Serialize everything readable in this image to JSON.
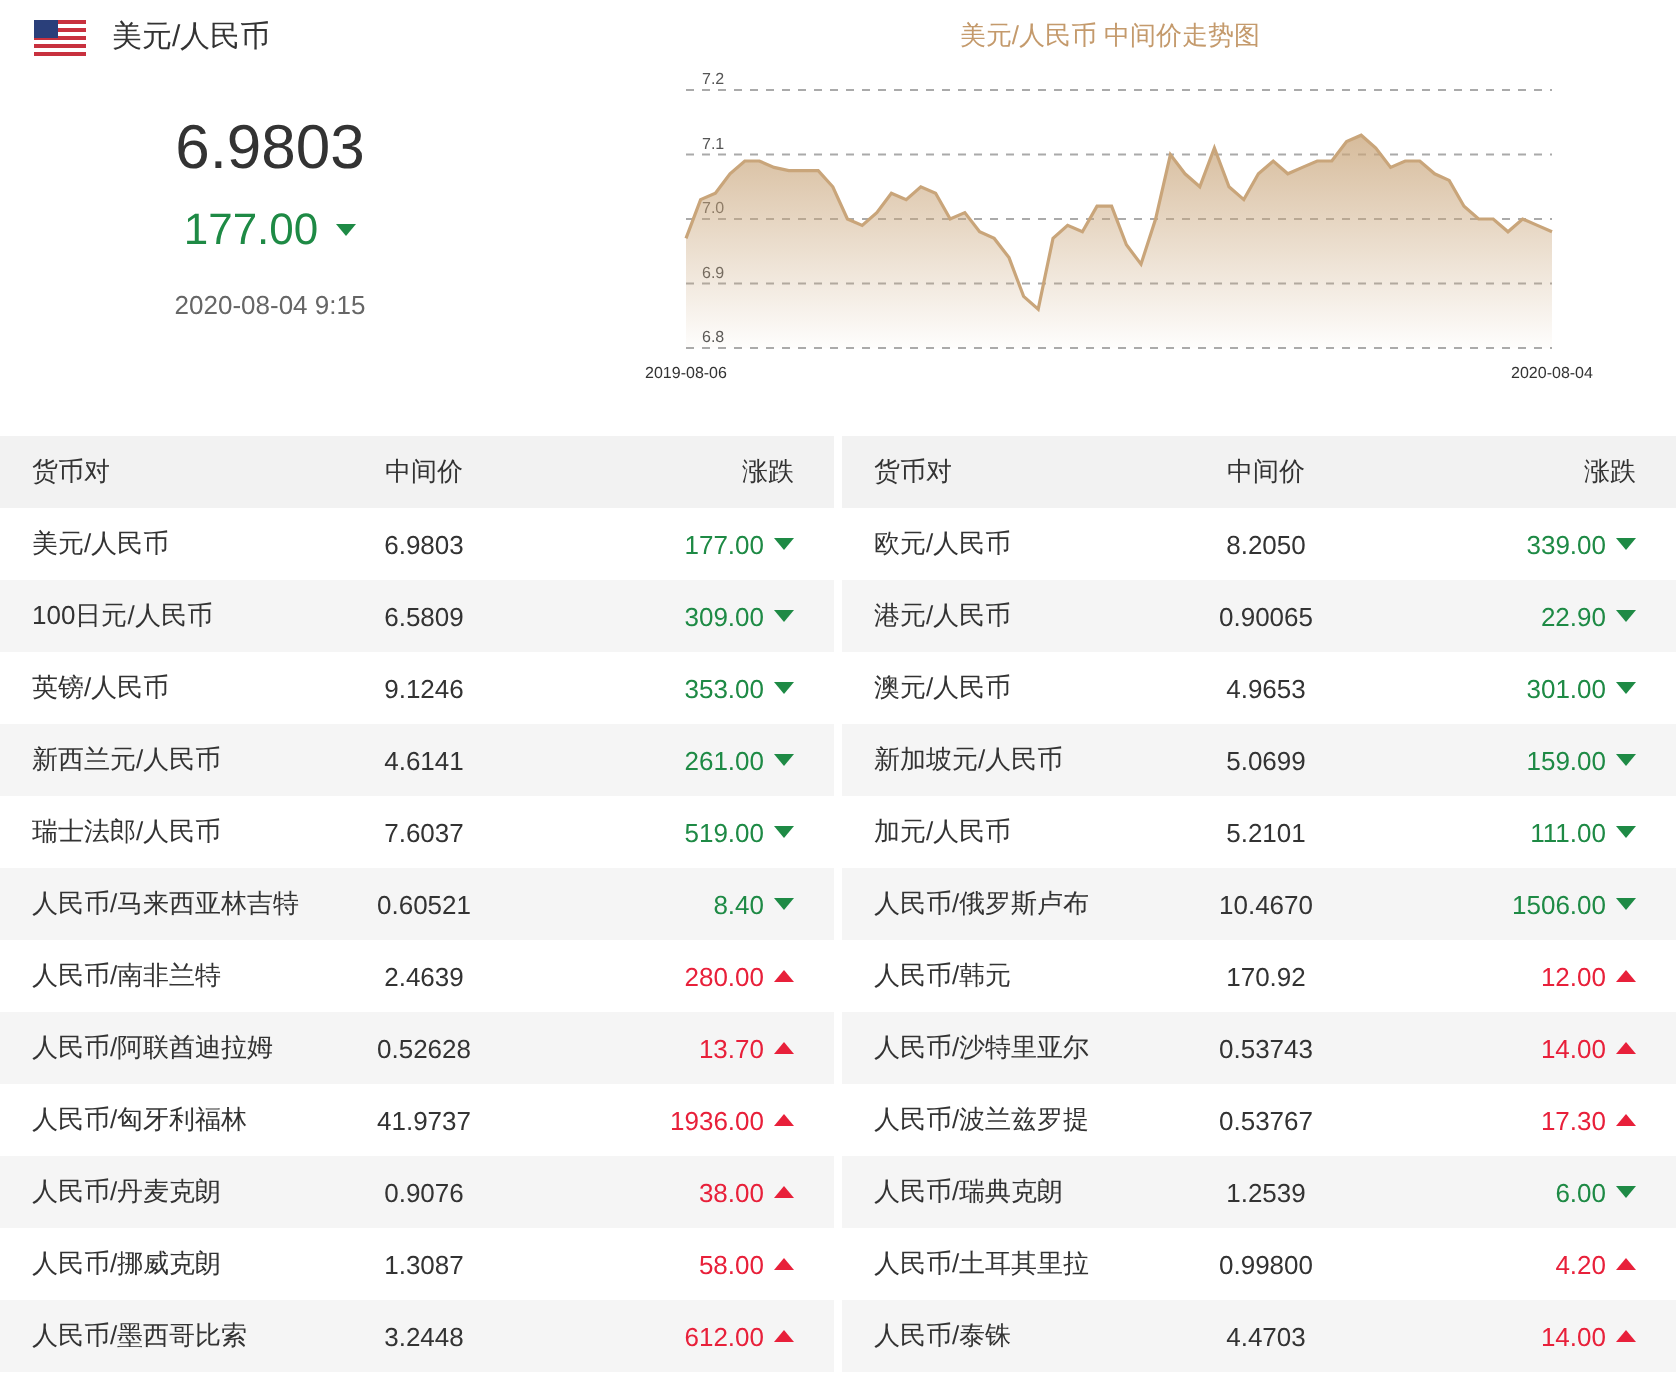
{
  "summary": {
    "pair": "美元/人民币",
    "price": "6.9803",
    "change": "177.00",
    "rising": false,
    "time": "2020-08-04 9:15"
  },
  "chart": {
    "title": "美元/人民币 中间价走势图",
    "x_start": "2019-08-06",
    "x_end": "2020-08-04",
    "chart_data": {
      "type": "area",
      "grid": true,
      "yticks": [
        6.8,
        6.9,
        {
          "value": 7,
          "label": "7.0"
        },
        7.1,
        7.2
      ],
      "ylim": [
        6.8,
        7.2
      ],
      "series": [
        {
          "color": "#c9a57a",
          "values": [
            6.97,
            7.03,
            7.04,
            7.07,
            7.09,
            7.09,
            7.08,
            7.075,
            7.075,
            7.075,
            7.05,
            7.0,
            6.99,
            7.01,
            7.04,
            7.03,
            7.05,
            7.04,
            7.0,
            7.01,
            6.98,
            6.97,
            6.94,
            6.88,
            6.86,
            6.97,
            6.99,
            6.98,
            7.02,
            7.02,
            6.96,
            6.93,
            7.0,
            7.1,
            7.07,
            7.05,
            7.11,
            7.05,
            7.03,
            7.07,
            7.09,
            7.07,
            7.08,
            7.09,
            7.09,
            7.12,
            7.13,
            7.11,
            7.08,
            7.09,
            7.09,
            7.07,
            7.06,
            7.02,
            7.0,
            7.0,
            6.98,
            7.0,
            6.99,
            6.98
          ]
        }
      ]
    }
  },
  "tables": [
    {
      "columns": [
        "货币对",
        "中间价",
        "涨跌"
      ],
      "rows": [
        {
          "pair": "美元/人民币",
          "price": "6.9803",
          "change": "177.00",
          "rising": false
        },
        {
          "pair": "100日元/人民币",
          "price": "6.5809",
          "change": "309.00",
          "rising": false
        },
        {
          "pair": "英镑/人民币",
          "price": "9.1246",
          "change": "353.00",
          "rising": false
        },
        {
          "pair": "新西兰元/人民币",
          "price": "4.6141",
          "change": "261.00",
          "rising": false
        },
        {
          "pair": "瑞士法郎/人民币",
          "price": "7.6037",
          "change": "519.00",
          "rising": false
        },
        {
          "pair": "人民币/马来西亚林吉特",
          "price": "0.60521",
          "change": "8.40",
          "rising": false
        },
        {
          "pair": "人民币/南非兰特",
          "price": "2.4639",
          "change": "280.00",
          "rising": true
        },
        {
          "pair": "人民币/阿联酋迪拉姆",
          "price": "0.52628",
          "change": "13.70",
          "rising": true
        },
        {
          "pair": "人民币/匈牙利福林",
          "price": "41.9737",
          "change": "1936.00",
          "rising": true
        },
        {
          "pair": "人民币/丹麦克朗",
          "price": "0.9076",
          "change": "38.00",
          "rising": true
        },
        {
          "pair": "人民币/挪威克朗",
          "price": "1.3087",
          "change": "58.00",
          "rising": true
        },
        {
          "pair": "人民币/墨西哥比索",
          "price": "3.2448",
          "change": "612.00",
          "rising": true
        }
      ]
    },
    {
      "columns": [
        "货币对",
        "中间价",
        "涨跌"
      ],
      "rows": [
        {
          "pair": "欧元/人民币",
          "price": "8.2050",
          "change": "339.00",
          "rising": false
        },
        {
          "pair": "港元/人民币",
          "price": "0.90065",
          "change": "22.90",
          "rising": false
        },
        {
          "pair": "澳元/人民币",
          "price": "4.9653",
          "change": "301.00",
          "rising": false
        },
        {
          "pair": "新加坡元/人民币",
          "price": "5.0699",
          "change": "159.00",
          "rising": false
        },
        {
          "pair": "加元/人民币",
          "price": "5.2101",
          "change": "111.00",
          "rising": false
        },
        {
          "pair": "人民币/俄罗斯卢布",
          "price": "10.4670",
          "change": "1506.00",
          "rising": false
        },
        {
          "pair": "人民币/韩元",
          "price": "170.92",
          "change": "12.00",
          "rising": true
        },
        {
          "pair": "人民币/沙特里亚尔",
          "price": "0.53743",
          "change": "14.00",
          "rising": true
        },
        {
          "pair": "人民币/波兰兹罗提",
          "price": "0.53767",
          "change": "17.30",
          "rising": true
        },
        {
          "pair": "人民币/瑞典克朗",
          "price": "1.2539",
          "change": "6.00",
          "rising": false
        },
        {
          "pair": "人民币/土耳其里拉",
          "price": "0.99800",
          "change": "4.20",
          "rising": true
        },
        {
          "pair": "人民币/泰铢",
          "price": "4.4703",
          "change": "14.00",
          "rising": true
        }
      ]
    }
  ]
}
